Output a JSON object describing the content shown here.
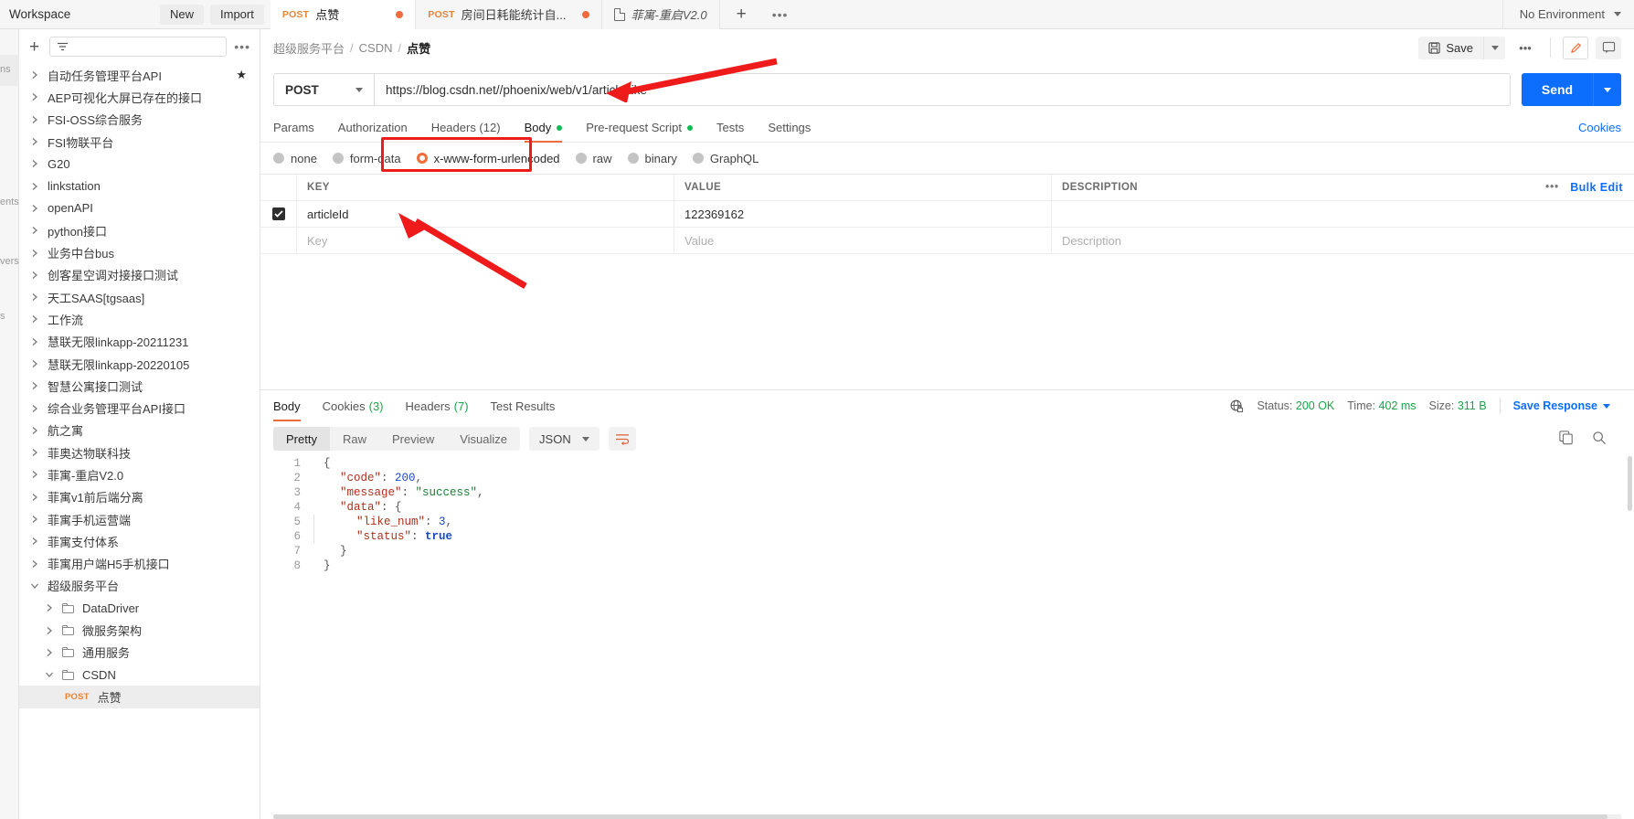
{
  "topbar": {
    "workspace_label": "Workspace",
    "new_label": "New",
    "import_label": "Import",
    "environment_label": "No Environment",
    "tabs": [
      {
        "method": "POST",
        "name": "点赞",
        "unsaved": true,
        "active": true,
        "type": "request"
      },
      {
        "method": "POST",
        "name": "房间日耗能统计自...",
        "unsaved": true,
        "active": false,
        "type": "request"
      },
      {
        "method": "",
        "name": "菲寓-重启V2.0",
        "unsaved": false,
        "active": false,
        "type": "collection"
      }
    ],
    "add_tab_label": "+",
    "more_label": "•••"
  },
  "rail": {
    "items": [
      "ns",
      "ents",
      "vers",
      "s"
    ]
  },
  "sidebar": {
    "filter_placeholder": "",
    "add_label": "+",
    "more_label": "•••",
    "items": [
      {
        "label": "自动任务管理平台API",
        "level": 1,
        "expanded": false,
        "starred": true
      },
      {
        "label": "AEP可视化大屏已存在的接口",
        "level": 1,
        "expanded": false
      },
      {
        "label": "FSI-OSS综合服务",
        "level": 1,
        "expanded": false
      },
      {
        "label": "FSI物联平台",
        "level": 1,
        "expanded": false
      },
      {
        "label": "G20",
        "level": 1,
        "expanded": false
      },
      {
        "label": "linkstation",
        "level": 1,
        "expanded": false
      },
      {
        "label": "openAPI",
        "level": 1,
        "expanded": false
      },
      {
        "label": "python接口",
        "level": 1,
        "expanded": false
      },
      {
        "label": "业务中台bus",
        "level": 1,
        "expanded": false
      },
      {
        "label": "创客星空调对接接口测试",
        "level": 1,
        "expanded": false
      },
      {
        "label": "天工SAAS[tgsaas]",
        "level": 1,
        "expanded": false
      },
      {
        "label": "工作流",
        "level": 1,
        "expanded": false
      },
      {
        "label": "慧联无限linkapp-20211231",
        "level": 1,
        "expanded": false
      },
      {
        "label": "慧联无限linkapp-20220105",
        "level": 1,
        "expanded": false
      },
      {
        "label": "智慧公寓接口测试",
        "level": 1,
        "expanded": false
      },
      {
        "label": "综合业务管理平台API接口",
        "level": 1,
        "expanded": false
      },
      {
        "label": "航之寓",
        "level": 1,
        "expanded": false
      },
      {
        "label": "菲奥达物联科技",
        "level": 1,
        "expanded": false
      },
      {
        "label": "菲寓-重启V2.0",
        "level": 1,
        "expanded": false
      },
      {
        "label": "菲寓v1前后端分离",
        "level": 1,
        "expanded": false
      },
      {
        "label": "菲寓手机运营端",
        "level": 1,
        "expanded": false
      },
      {
        "label": "菲寓支付体系",
        "level": 1,
        "expanded": false
      },
      {
        "label": "菲寓用户端H5手机接口",
        "level": 1,
        "expanded": false
      },
      {
        "label": "超级服务平台",
        "level": 1,
        "expanded": true
      },
      {
        "label": "DataDriver",
        "level": 2,
        "expanded": false,
        "folder": true
      },
      {
        "label": "微服务架构",
        "level": 2,
        "expanded": false,
        "folder": true
      },
      {
        "label": "通用服务",
        "level": 2,
        "expanded": false,
        "folder": true
      },
      {
        "label": "CSDN",
        "level": 2,
        "expanded": true,
        "folder": true
      },
      {
        "label": "点赞",
        "level": 3,
        "method": "POST",
        "selected": true
      }
    ]
  },
  "request": {
    "breadcrumb": [
      "超级服务平台",
      "CSDN",
      "点赞"
    ],
    "save_label": "Save",
    "more_label": "•••",
    "method": "POST",
    "url": "https://blog.csdn.net//phoenix/web/v1/article/like",
    "send_label": "Send",
    "tabs": [
      {
        "label": "Params",
        "active": false
      },
      {
        "label": "Authorization",
        "active": false
      },
      {
        "label": "Headers (12)",
        "active": false
      },
      {
        "label": "Body",
        "active": true,
        "dot": true
      },
      {
        "label": "Pre-request Script",
        "active": false,
        "dot": true
      },
      {
        "label": "Tests",
        "active": false
      },
      {
        "label": "Settings",
        "active": false
      }
    ],
    "cookies_label": "Cookies",
    "body_types": [
      {
        "label": "none",
        "selected": false
      },
      {
        "label": "form-data",
        "selected": false
      },
      {
        "label": "x-www-form-urlencoded",
        "selected": true
      },
      {
        "label": "raw",
        "selected": false
      },
      {
        "label": "binary",
        "selected": false
      },
      {
        "label": "GraphQL",
        "selected": false
      }
    ],
    "table": {
      "headers": [
        "KEY",
        "VALUE",
        "DESCRIPTION"
      ],
      "bulk_label": "Bulk Edit",
      "more_label": "•••",
      "rows": [
        {
          "checked": true,
          "key": "articleId",
          "value": "122369162",
          "description": ""
        }
      ],
      "placeholder_row": {
        "key": "Key",
        "value": "Value",
        "description": "Description"
      }
    }
  },
  "response": {
    "tabs": [
      {
        "label": "Body",
        "count": "",
        "active": true
      },
      {
        "label": "Cookies",
        "count": "(3)",
        "active": false
      },
      {
        "label": "Headers",
        "count": "(7)",
        "active": false
      },
      {
        "label": "Test Results",
        "count": "",
        "active": false
      }
    ],
    "status_label": "Status:",
    "status_value": "200 OK",
    "time_label": "Time:",
    "time_value": "402 ms",
    "size_label": "Size:",
    "size_value": "311 B",
    "save_response_label": "Save Response",
    "view_modes": [
      {
        "label": "Pretty",
        "active": true
      },
      {
        "label": "Raw",
        "active": false
      },
      {
        "label": "Preview",
        "active": false
      },
      {
        "label": "Visualize",
        "active": false
      }
    ],
    "format": "JSON",
    "body_lines": [
      {
        "n": "1",
        "indent": 0,
        "gutter": false,
        "tokens": [
          {
            "t": "{",
            "c": "p"
          }
        ]
      },
      {
        "n": "2",
        "indent": 1,
        "gutter": false,
        "tokens": [
          {
            "t": "\"code\"",
            "c": "k"
          },
          {
            "t": ": ",
            "c": "p"
          },
          {
            "t": "200",
            "c": "n"
          },
          {
            "t": ",",
            "c": "p"
          }
        ]
      },
      {
        "n": "3",
        "indent": 1,
        "gutter": false,
        "tokens": [
          {
            "t": "\"message\"",
            "c": "k"
          },
          {
            "t": ": ",
            "c": "p"
          },
          {
            "t": "\"success\"",
            "c": "s"
          },
          {
            "t": ",",
            "c": "p"
          }
        ]
      },
      {
        "n": "4",
        "indent": 1,
        "gutter": false,
        "tokens": [
          {
            "t": "\"data\"",
            "c": "k"
          },
          {
            "t": ": {",
            "c": "p"
          }
        ]
      },
      {
        "n": "5",
        "indent": 2,
        "gutter": true,
        "tokens": [
          {
            "t": "\"like_num\"",
            "c": "k"
          },
          {
            "t": ": ",
            "c": "p"
          },
          {
            "t": "3",
            "c": "n"
          },
          {
            "t": ",",
            "c": "p"
          }
        ]
      },
      {
        "n": "6",
        "indent": 2,
        "gutter": true,
        "tokens": [
          {
            "t": "\"status\"",
            "c": "k"
          },
          {
            "t": ": ",
            "c": "p"
          },
          {
            "t": "true",
            "c": "b"
          }
        ]
      },
      {
        "n": "7",
        "indent": 1,
        "gutter": false,
        "tokens": [
          {
            "t": "}",
            "c": "p"
          }
        ]
      },
      {
        "n": "8",
        "indent": 0,
        "gutter": false,
        "tokens": [
          {
            "t": "}",
            "c": "p"
          }
        ]
      }
    ]
  },
  "annotations": {
    "url_arrow": "arrow pointing to url input",
    "body_type_box": "red rectangle around x-www-form-urlencoded",
    "key_arrow": "arrow pointing to articleId key cell"
  },
  "colors": {
    "accent_orange": "#f26b3a",
    "send_blue": "#0d6efd",
    "status_green": "#1aa34a",
    "annotation_red": "#ef1b1b",
    "method_orange": "#e8833a"
  }
}
